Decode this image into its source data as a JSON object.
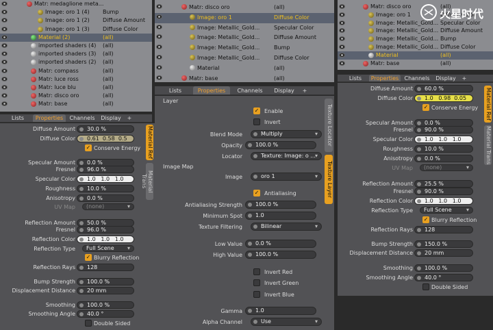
{
  "left": {
    "tree": [
      {
        "name": "Matr: medaglione meta...",
        "col2": ""
      },
      {
        "name": "Image: oro 1 (4)",
        "col2": "Bump"
      },
      {
        "name": "Image: oro 1 (2)",
        "col2": "Diffuse Amount"
      },
      {
        "name": "Image: oro 1 (3)",
        "col2": "Diffuse Color"
      },
      {
        "name": "Material (2)",
        "col2": "(all)"
      },
      {
        "name": "imported shaders (4)",
        "col2": "(all)"
      },
      {
        "name": "imported shaders (3)",
        "col2": "(all)"
      },
      {
        "name": "imported shaders (2)",
        "col2": "(all)"
      },
      {
        "name": "Matr: compass",
        "col2": "(all)"
      },
      {
        "name": "Matr: luce ross",
        "col2": "(all)"
      },
      {
        "name": "Matr: luce blu",
        "col2": "(all)"
      },
      {
        "name": "Matr: disco oro",
        "col2": "(all)"
      },
      {
        "name": "Matr: base",
        "col2": "(all)"
      }
    ],
    "tabs": [
      "Lists",
      "Properties",
      "Channels",
      "Display",
      "+"
    ],
    "vtabs": [
      "Material Ref",
      "Material Trans"
    ],
    "diffuse_amount_label": "Diffuse Amount",
    "diffuse_amount": "30.0 %",
    "diffuse_color_label": "Diffuse Color",
    "diffuse_color": [
      "0.61",
      "0.58",
      "0.5"
    ],
    "conserve_energy": "Conserve Energy",
    "specular_amount_label": "Specular Amount",
    "specular_amount": "0.0 %",
    "fresnel_label": "Fresnel",
    "fresnel": "96.0 %",
    "specular_color_label": "Specular Color",
    "specular_color": [
      "1.0",
      "1.0",
      "1.0"
    ],
    "roughness_label": "Roughness",
    "roughness": "10.0 %",
    "anisotropy_label": "Anisotropy",
    "anisotropy": "0.0 %",
    "uvmap_label": "UV Map",
    "uvmap": "(none)",
    "reflection_amount_label": "Reflection Amount",
    "reflection_amount": "50.0 %",
    "fresnel2": "96.0 %",
    "reflection_color_label": "Reflection Color",
    "reflection_color": [
      "1.0",
      "1.0",
      "1.0"
    ],
    "reflection_type_label": "Reflection Type",
    "reflection_type": "Full Scene",
    "blurry_reflection": "Blurry Reflection",
    "reflection_rays_label": "Reflection Rays",
    "reflection_rays": "128",
    "bump_strength_label": "Bump Strength",
    "bump_strength": "100.0 %",
    "displacement_distance_label": "Displacement Distance",
    "displacement_distance": "20 mm",
    "smoothing_label": "Smoothing",
    "smoothing": "100.0 %",
    "smoothing_angle_label": "Smoothing Angle",
    "smoothing_angle": "40.0 °",
    "double_sided": "Double Sided"
  },
  "middle": {
    "tree": [
      {
        "name": "Matr: disco oro",
        "col2": "(all)"
      },
      {
        "name": "Image: oro 1",
        "col2": "Diffuse Color"
      },
      {
        "name": "Image: Metallic_Gold...",
        "col2": "Specular Color"
      },
      {
        "name": "Image: Metallic_Gold...",
        "col2": "Diffuse Amount"
      },
      {
        "name": "Image: Metallic_Gold...",
        "col2": "Bump"
      },
      {
        "name": "Image: Metallic_Gold...",
        "col2": "Diffuse Color"
      },
      {
        "name": "Material",
        "col2": "(all)"
      },
      {
        "name": "Matr: base",
        "col2": "(all)"
      }
    ],
    "tabs": [
      "Lists",
      "Properties",
      "Channels",
      "Display",
      "+"
    ],
    "vtabs": [
      "Texture Locator",
      "Texture Layer"
    ],
    "layer_section": "Layer",
    "enable": "Enable",
    "invert": "Invert",
    "blend_mode_label": "Blend Mode",
    "blend_mode": "Multiply",
    "opacity_label": "Opacity",
    "opacity": "100.0 %",
    "locator_label": "Locator",
    "locator": "Texture: Image: o ...",
    "image_map_section": "Image Map",
    "image_label": "Image",
    "image": "oro 1",
    "antialiasing": "Antialiasing",
    "antialiasing_strength_label": "Antialiasing Strength",
    "antialiasing_strength": "100.0 %",
    "minimum_spot_label": "Minimum Spot",
    "minimum_spot": "1.0",
    "texture_filtering_label": "Texture Filtering",
    "texture_filtering": "Bilinear",
    "low_value_label": "Low Value",
    "low_value": "0.0 %",
    "high_value_label": "High Value",
    "high_value": "100.0 %",
    "invert_red": "Invert Red",
    "invert_green": "Invert Green",
    "invert_blue": "Invert Blue",
    "gamma_label": "Gamma",
    "gamma": "1.0",
    "alpha_channel_label": "Alpha Channel",
    "alpha_channel": "Use"
  },
  "right": {
    "tree": [
      {
        "name": "Matr: disco oro",
        "col2": "(all)"
      },
      {
        "name": "Image: oro 1",
        "col2": "Diffuse Color"
      },
      {
        "name": "Image: Metallic_Gold...",
        "col2": "Specular Color"
      },
      {
        "name": "Image: Metallic_Gold...",
        "col2": "Diffuse Amount"
      },
      {
        "name": "Image: Metallic_Gold...",
        "col2": "Bump"
      },
      {
        "name": "Image: Metallic_Gold...",
        "col2": "Diffuse Color"
      },
      {
        "name": "Material",
        "col2": "(all)"
      },
      {
        "name": "Matr: base",
        "col2": "(all)"
      }
    ],
    "tabs": [
      "Lists",
      "Properties",
      "Channels",
      "Display",
      "+"
    ],
    "vtabs": [
      "Material Ref",
      "Material Trans"
    ],
    "diffuse_amount": "60.0 %",
    "diffuse_color": [
      "1.0",
      "0.98",
      "0.05"
    ],
    "specular_amount": "0.0 %",
    "fresnel": "90.0 %",
    "specular_color": [
      "1.0",
      "1.0",
      "1.0"
    ],
    "roughness": "10.0 %",
    "anisotropy": "0.0 %",
    "uvmap": "(none)",
    "reflection_amount": "25.5 %",
    "fresnel2": "90.0 %",
    "reflection_color": [
      "1.0",
      "1.0",
      "1.0"
    ],
    "reflection_type": "Full Scene",
    "reflection_rays": "128",
    "bump_strength": "150.0 %",
    "displacement_distance": "20 mm",
    "smoothing": "100.0 %",
    "smoothing_angle": "40.0 °"
  },
  "watermark": "火星时代"
}
